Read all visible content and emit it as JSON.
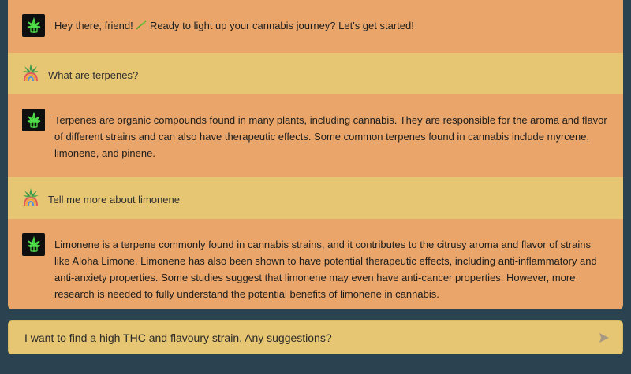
{
  "chat": {
    "messages": [
      {
        "role": "bot",
        "text_before": "Hey there, friend! ",
        "text_after": " Ready to light up your cannabis journey? Let's get started!"
      },
      {
        "role": "user",
        "text": "What are terpenes?"
      },
      {
        "role": "bot",
        "text": "Terpenes are organic compounds found in many plants, including cannabis. They are responsible for the aroma and flavor of different strains and can also have therapeutic effects. Some common terpenes found in cannabis include myrcene, limonene, and pinene."
      },
      {
        "role": "user",
        "text": "Tell me more about limonene"
      },
      {
        "role": "bot",
        "text": "Limonene is a terpene commonly found in cannabis strains, and it contributes to the citrusy aroma and flavor of strains like Aloha Limone. Limonene has also been shown to have potential therapeutic effects, including anti-inflammatory and anti-anxiety properties. Some studies suggest that limonene may even have anti-cancer properties. However, more research is needed to fully understand the potential benefits of limonene in cannabis."
      }
    ],
    "icons": {
      "bot_avatar": "cannabis-leaf-icon",
      "user_avatar": "cannabis-rainbow-icon",
      "greeting_emoji": "leaf-emoji-icon"
    }
  },
  "input": {
    "value": "I want to find a high THC and flavoury strain. Any suggestions?",
    "send_icon": "send-icon"
  },
  "colors": {
    "background": "#2b4251",
    "bot_message_bg": "#eaa66a",
    "user_message_bg": "#e6c673",
    "input_bg": "#e6c673"
  }
}
